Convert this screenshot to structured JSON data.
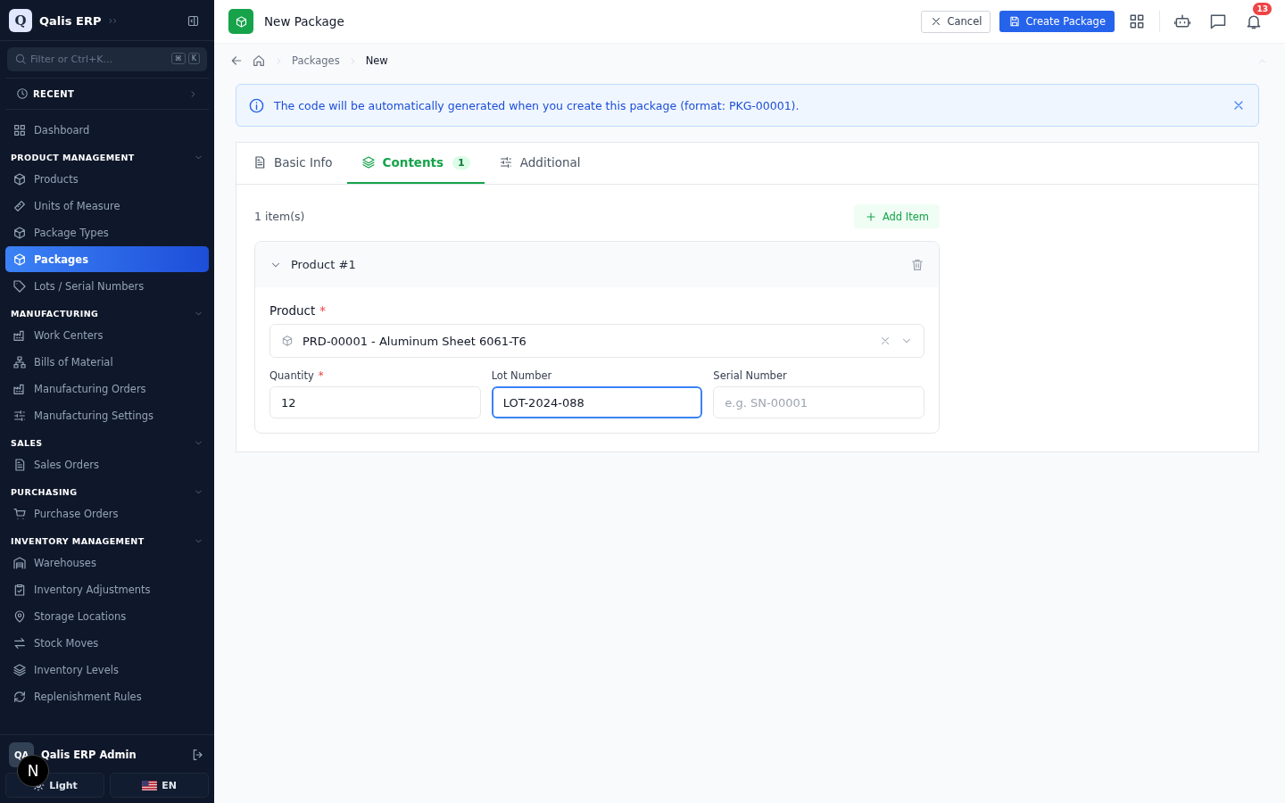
{
  "sidebar": {
    "brand": {
      "logo": "Q",
      "name": "Qalis ERP",
      "expand": "››"
    },
    "search": {
      "placeholder": "Filter or Ctrl+K...",
      "keys": [
        "⌘",
        "K"
      ]
    },
    "recent": "RECENT",
    "sections": [
      {
        "items": [
          {
            "label": "Dashboard",
            "selected": false
          }
        ]
      },
      {
        "title": "PRODUCT MANAGEMENT",
        "expanded": true,
        "items": [
          {
            "label": "Products",
            "selected": false
          },
          {
            "label": "Units of Measure",
            "selected": false
          },
          {
            "label": "Package Types",
            "selected": false
          },
          {
            "label": "Packages",
            "selected": true
          },
          {
            "label": "Lots / Serial Numbers",
            "selected": false
          }
        ]
      },
      {
        "title": "MANUFACTURING",
        "expanded": true,
        "items": [
          {
            "label": "Work Centers",
            "selected": false
          },
          {
            "label": "Bills of Material",
            "selected": false
          },
          {
            "label": "Manufacturing Orders",
            "selected": false
          },
          {
            "label": "Manufacturing Settings",
            "selected": false
          }
        ]
      },
      {
        "title": "SALES",
        "expanded": true,
        "items": [
          {
            "label": "Sales Orders",
            "selected": false
          }
        ]
      },
      {
        "title": "PURCHASING",
        "expanded": true,
        "items": [
          {
            "label": "Purchase Orders",
            "selected": false
          }
        ]
      },
      {
        "title": "INVENTORY MANAGEMENT",
        "expanded": true,
        "items": [
          {
            "label": "Warehouses",
            "selected": false
          },
          {
            "label": "Inventory Adjustments",
            "selected": false
          },
          {
            "label": "Storage Locations",
            "selected": false
          },
          {
            "label": "Stock Moves",
            "selected": false
          },
          {
            "label": "Inventory Levels",
            "selected": false
          },
          {
            "label": "Replenishment Rules",
            "selected": false
          }
        ]
      }
    ],
    "user": {
      "initials": "QA",
      "name": "Qalis ERP Admin"
    },
    "dev_badge": "N",
    "theme_button": "Light",
    "language_button": "EN"
  },
  "header": {
    "title": "New Package",
    "cancel": "Cancel",
    "create": "Create Package",
    "notification_count": "13"
  },
  "breadcrumb": [
    "Packages",
    "New"
  ],
  "alert": "The code will be automatically generated when you create this package (format: PKG-00001).",
  "tabs": [
    {
      "label": "Basic Info",
      "selected": false
    },
    {
      "label": "Contents",
      "selected": true,
      "count": "1"
    },
    {
      "label": "Additional",
      "selected": false
    }
  ],
  "contents": {
    "count_text": "1 item(s)",
    "add_button": "Add Item",
    "items": [
      {
        "title": "Product #1",
        "expanded": true,
        "product_label": "Product",
        "product_required_mark": "*",
        "product_value": "PRD-00001 - Aluminum Sheet 6061-T6",
        "fields": [
          {
            "label": "Quantity",
            "required_mark": "*",
            "value": "12",
            "focused": false
          },
          {
            "label": "Lot Number",
            "value": "LOT-2024-088",
            "focused": true
          },
          {
            "label": "Serial Number",
            "placeholder": "e.g. SN-00001",
            "focused": false
          }
        ]
      }
    ]
  }
}
